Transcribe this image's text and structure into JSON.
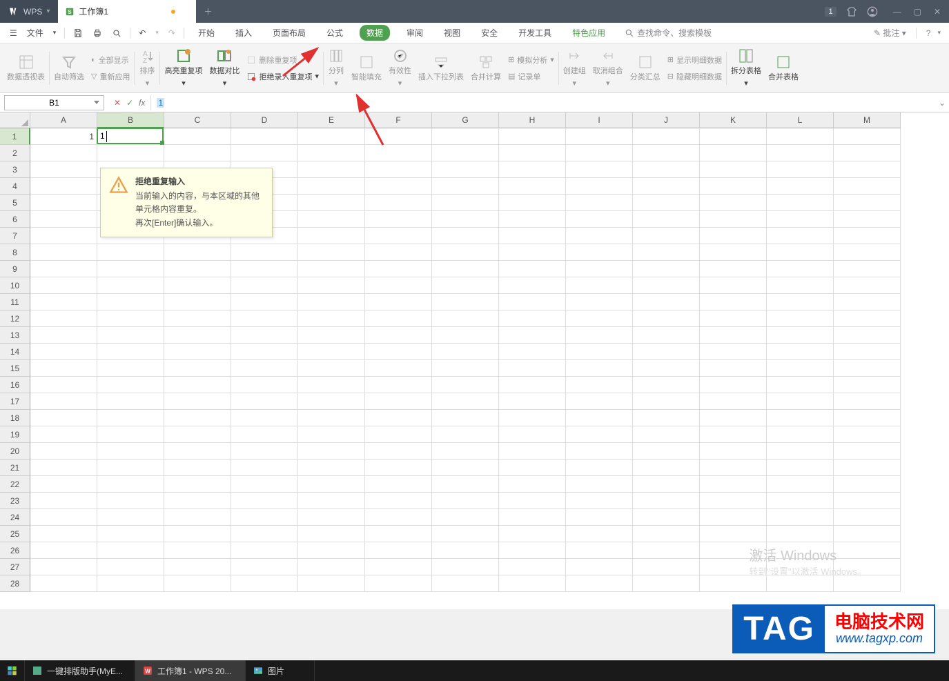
{
  "titlebar": {
    "logo_text": "WPS",
    "doc_tab": "工作簿1",
    "badge": "1"
  },
  "quickbar": {
    "file_label": "文件"
  },
  "menu": {
    "tabs": [
      "开始",
      "插入",
      "页面布局",
      "公式",
      "数据",
      "审阅",
      "视图",
      "安全",
      "开发工具",
      "特色应用"
    ],
    "active_index": 4,
    "search_label": "查找命令、搜索模板",
    "annotate_label": "批注"
  },
  "ribbon": {
    "pivot": "数据透视表",
    "autofilter": "自动筛选",
    "show_all": "全部显示",
    "reapply": "重新应用",
    "sort": "排序",
    "highlight_dup": "高亮重复项",
    "data_compare": "数据对比",
    "remove_dup": "删除重复项",
    "reject_dup": "拒绝录入重复项",
    "text_to_cols": "分列",
    "flash_fill": "智能填充",
    "validity": "有效性",
    "insert_dropdown": "插入下拉列表",
    "consolidate": "合并计算",
    "what_if": "模拟分析",
    "form": "记录单",
    "group": "创建组",
    "ungroup": "取消组合",
    "subtotal": "分类汇总",
    "show_detail": "显示明细数据",
    "hide_detail": "隐藏明细数据",
    "split_table": "拆分表格",
    "merge_table": "合并表格"
  },
  "formula_bar": {
    "name_box": "B1",
    "fx_value": "1"
  },
  "columns": [
    "A",
    "B",
    "C",
    "D",
    "E",
    "F",
    "G",
    "H",
    "I",
    "J",
    "K",
    "L",
    "M"
  ],
  "row_count": 28,
  "active": {
    "col": 1,
    "row": 0
  },
  "cells": {
    "A1": "1",
    "B1_editing": "1"
  },
  "tooltip": {
    "title": "拒绝重复输入",
    "line1": "当前输入的内容，与本区域的其他单元格内容重复。",
    "line2": "再次[Enter]确认输入。"
  },
  "watermark": {
    "l1": "激活 Windows",
    "l2": "转到\"设置\"以激活 Windows。"
  },
  "tag": {
    "left": "TAG",
    "right": "电脑技术网",
    "url": "www.tagxp.com"
  },
  "taskbar": {
    "items": [
      {
        "label": "一键排版助手(MyE...",
        "icon": "app"
      },
      {
        "label": "工作簿1 - WPS 20...",
        "icon": "wps"
      },
      {
        "label": "图片",
        "icon": "pic"
      }
    ]
  }
}
